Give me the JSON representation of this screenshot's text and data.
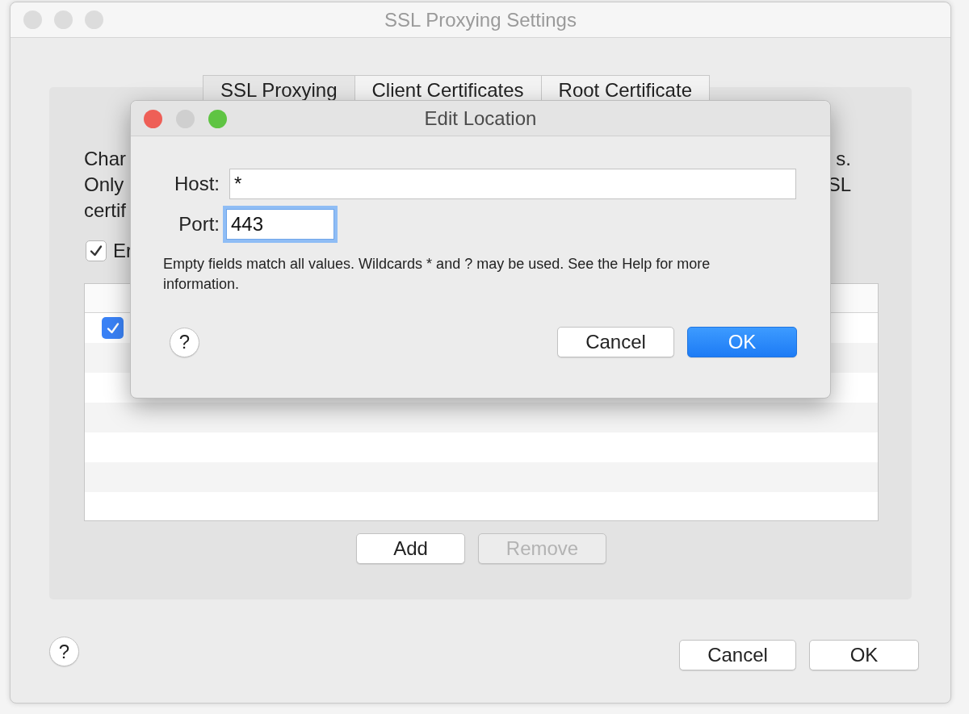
{
  "window": {
    "title": "SSL Proxying Settings"
  },
  "tabs": [
    {
      "label": "SSL Proxying",
      "selected": true
    },
    {
      "label": "Client Certificates",
      "selected": false
    },
    {
      "label": "Root Certificate",
      "selected": false
    }
  ],
  "description_lines": [
    {
      "left": "Char",
      "right": "s."
    },
    {
      "left": "Only",
      "right": "SL"
    },
    {
      "left": "certif"
    }
  ],
  "enable_checkbox": {
    "label": "Er",
    "checked": true
  },
  "locations_table": {
    "rows": [
      {
        "enabled": true
      }
    ]
  },
  "table_buttons": [
    {
      "label": "Add",
      "disabled": false
    },
    {
      "label": "Remove",
      "disabled": true
    }
  ],
  "help_button": {
    "label": "?"
  },
  "footer_buttons": [
    {
      "label": "Cancel",
      "default": false
    },
    {
      "label": "OK",
      "default": false
    }
  ],
  "dialog": {
    "title": "Edit Location",
    "fields": [
      {
        "label": "Host:",
        "value": "*",
        "kind": "wide",
        "focused": false
      },
      {
        "label": "Port:",
        "value": "443",
        "kind": "narrow",
        "focused": true
      }
    ],
    "hint": "Empty fields match all values. Wildcards * and ? may be used. See the Help for more information.",
    "help_label": "?",
    "buttons": [
      {
        "label": "Cancel",
        "default": false
      },
      {
        "label": "OK",
        "default": true
      }
    ]
  }
}
